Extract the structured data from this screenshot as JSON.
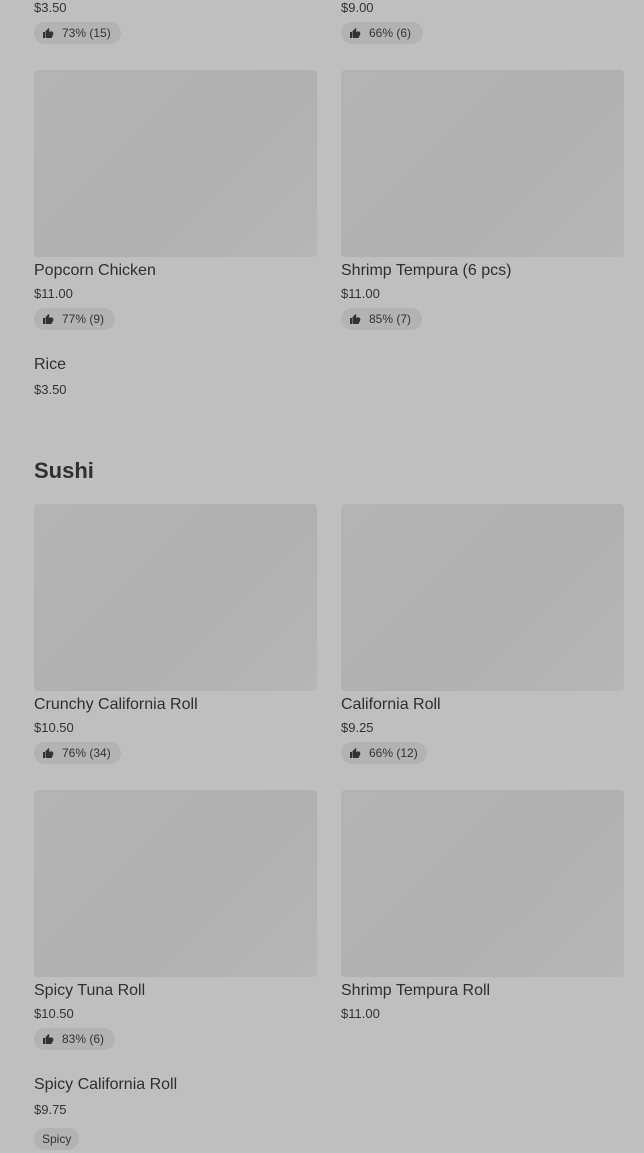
{
  "top_partial": [
    {
      "price": "$3.50",
      "rating": "73% (15)"
    },
    {
      "price": "$9.00",
      "rating": "66% (6)"
    }
  ],
  "items_row1": [
    {
      "name": "Popcorn Chicken",
      "price": "$11.00",
      "rating": "77% (9)"
    },
    {
      "name": "Shrimp Tempura (6 pcs)",
      "price": "$11.00",
      "rating": "85% (7)"
    }
  ],
  "rice": {
    "name": "Rice",
    "price": "$3.50"
  },
  "sushi": {
    "title": "Sushi",
    "items": [
      {
        "name": "Crunchy California Roll",
        "price": "$10.50",
        "rating": "76% (34)"
      },
      {
        "name": "California Roll",
        "price": "$9.25",
        "rating": "66% (12)"
      },
      {
        "name": "Spicy Tuna Roll",
        "price": "$10.50",
        "rating": "83% (6)"
      },
      {
        "name": "Shrimp Tempura Roll",
        "price": "$11.00"
      }
    ],
    "spicy_california": {
      "name": "Spicy California Roll",
      "price": "$9.75",
      "tag": "Spicy"
    }
  }
}
